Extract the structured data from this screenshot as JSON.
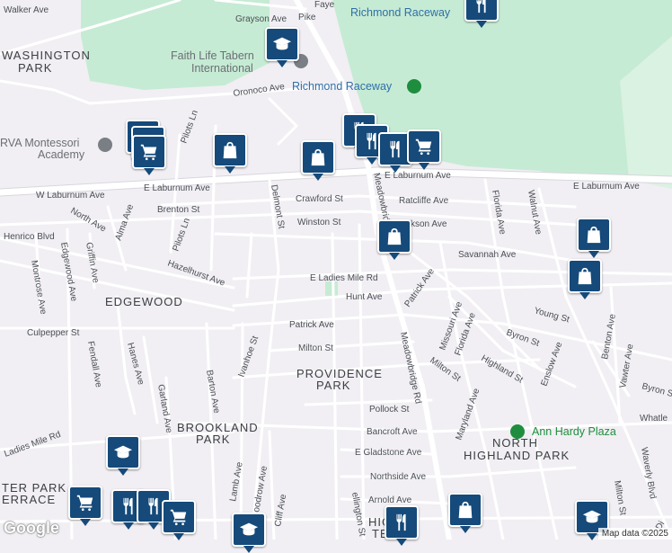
{
  "map_labels": {
    "areas": {
      "washington_park": [
        "WASHINGTON",
        "PARK"
      ],
      "edgewood": "EDGEWOOD",
      "providence_park": [
        "PROVIDENCE",
        "PARK"
      ],
      "brookland_park": [
        "BROOKLAND",
        "PARK"
      ],
      "north_highland_park": [
        "NORTH",
        "HIGHLAND PARK"
      ],
      "ter_park_terrace": [
        "TER PARK",
        "ERRACE"
      ],
      "highland_terrace": [
        "HIGH",
        "TE"
      ]
    },
    "pois": {
      "richmond_raceway_top": "Richmond Raceway",
      "richmond_raceway": "Richmond Raceway",
      "faith_life": [
        "Faith Life Tabern",
        "International"
      ],
      "montessori": [
        "RVA Montessori",
        "Academy"
      ],
      "ann_hardy": "Ann Hardy Plaza"
    },
    "streets": {
      "walker": "Walker Ave",
      "grayson": "Grayson Ave",
      "pike": "Pike",
      "faye": "Faye",
      "oronoco": "Oronoco Ave",
      "pilots_ln_top": "Pilots Ln",
      "e_laburnum_center": "E Laburnum Ave",
      "e_laburnum_left": "E Laburnum Ave",
      "w_laburnum": "W Laburnum Ave",
      "e_laburnum_right": "E Laburnum Ave",
      "crawford": "Crawford St",
      "ratcliffe": "Ratcliffe Ave",
      "brenton": "Brenton St",
      "north_ave": "North Ave",
      "alma": "Alma Ave",
      "delmont": "Delmont St",
      "meadowbridge_upper": "Meadowbridge Rd",
      "winston": "Winston St",
      "jackson": "ckson Ave",
      "florida_upper": "Florida Ave",
      "walnut": "Walnut Ave",
      "henrico": "Henrico Blvd",
      "pilots_ln": "Pilots Ln",
      "savannah": "Savannah Ave",
      "montrose": "Montrose Ave",
      "edgewood_ave": "Edgewood Ave",
      "griffin": "Griffin Ave",
      "hazelhurst": "Hazelhurst Ave",
      "ladies_mile": "E Ladies Mile Rd",
      "hunt": "Hunt Ave",
      "patrick_upper": "Patrick Ave",
      "young": "Young St",
      "culpepper": "Culpepper St",
      "patrick": "Patrick Ave",
      "missouri": "Missouri Ave",
      "florida": "Florida Ave",
      "byron": "Byron St",
      "benton": "Benton Ave",
      "fendall": "Fendall Ave",
      "hanes": "Hanes Ave",
      "milton": "Milton St",
      "ivanhoe": "Ivanhoe St",
      "meadowbridge": "Meadowbridge Rd",
      "milton_e": "Milton St",
      "highland": "Highland St",
      "enslow": "Enslow Ave",
      "vawter": "Vawter Ave",
      "byron_e": "Byron St",
      "garland": "Garland Ave",
      "barton": "Barton Ave",
      "pollock": "Pollock St",
      "maryland": "Maryland Ave",
      "whatley": "Whatle",
      "ladies_mile_w": "Ladies Mile Rd",
      "bancroft": "Bancroft Ave",
      "lamb": "Lamb Ave",
      "woodrow": "oodrow Ave",
      "gladstone": "E Gladstone Ave",
      "northside": "Northside Ave",
      "waverly": "Waverly Blvd",
      "milton_se": "Milton St",
      "arnold": "Arnold Ave",
      "cliff": "Cliff Ave",
      "wellington": "ellington St",
      "di": "Di"
    }
  },
  "markers": [
    {
      "type": "school",
      "icon": "graduation-cap-icon"
    },
    {
      "type": "restaurant",
      "icon": "fork-knife-icon"
    },
    {
      "type": "store",
      "icon": "shopping-bag-icon"
    },
    {
      "type": "restaurant",
      "icon": "fork-knife-icon"
    },
    {
      "type": "restaurant",
      "icon": "fork-knife-icon"
    },
    {
      "type": "restaurant",
      "icon": "fork-knife-icon"
    },
    {
      "type": "grocery",
      "icon": "shopping-cart-icon"
    },
    {
      "type": "grocery",
      "icon": "shopping-cart-icon"
    },
    {
      "type": "grocery",
      "icon": "shopping-cart-icon"
    },
    {
      "type": "grocery",
      "icon": "shopping-cart-icon"
    },
    {
      "type": "store",
      "icon": "shopping-bag-icon"
    },
    {
      "type": "store",
      "icon": "shopping-bag-icon"
    },
    {
      "type": "store",
      "icon": "shopping-bag-icon"
    },
    {
      "type": "store",
      "icon": "shopping-bag-icon"
    },
    {
      "type": "school",
      "icon": "graduation-cap-icon"
    },
    {
      "type": "grocery",
      "icon": "shopping-cart-icon"
    },
    {
      "type": "restaurant",
      "icon": "fork-knife-icon"
    },
    {
      "type": "restaurant",
      "icon": "fork-knife-icon"
    },
    {
      "type": "grocery",
      "icon": "shopping-cart-icon"
    },
    {
      "type": "school",
      "icon": "graduation-cap-icon"
    },
    {
      "type": "restaurant",
      "icon": "fork-knife-icon"
    },
    {
      "type": "store",
      "icon": "shopping-bag-icon"
    },
    {
      "type": "school",
      "icon": "graduation-cap-icon"
    }
  ],
  "logo": "Google",
  "attribution": "Map data ©2025",
  "colors": {
    "park": "#c6ebd4",
    "water_green": "#daf2e1",
    "poi_blue": "#2f6fa8",
    "poi_green": "#1e8e3e",
    "marker": "#154a7a"
  }
}
